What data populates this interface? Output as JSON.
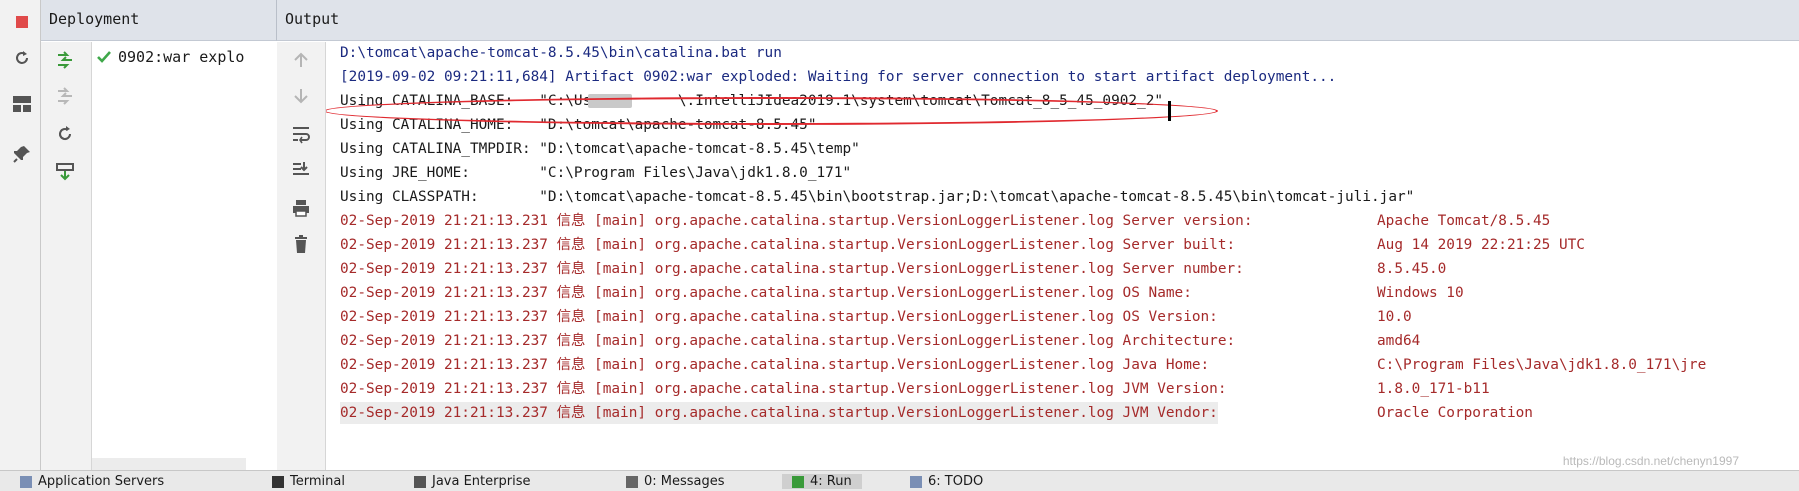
{
  "panels": {
    "deployment_title": "Deployment",
    "output_title": "Output"
  },
  "deployment": {
    "items": [
      {
        "label": "0902:war explo",
        "status": "deployed"
      }
    ]
  },
  "console": {
    "lines": [
      {
        "kind": "cmd",
        "text": "D:\\tomcat\\apache-tomcat-8.5.45\\bin\\catalina.bat run"
      },
      {
        "kind": "info",
        "text": "[2019-09-02 09:21:11,684] Artifact 0902:war exploded: Waiting for server connection to start artifact deployment..."
      },
      {
        "kind": "out",
        "text": "Using CATALINA_BASE:   \"C:\\Users\\      \\.IntelliJIdea2019.1\\system\\tomcat\\Tomcat_8_5_45_0902_2\""
      },
      {
        "kind": "out",
        "text": "Using CATALINA_HOME:   \"D:\\tomcat\\apache-tomcat-8.5.45\""
      },
      {
        "kind": "out",
        "text": "Using CATALINA_TMPDIR: \"D:\\tomcat\\apache-tomcat-8.5.45\\temp\""
      },
      {
        "kind": "out",
        "text": "Using JRE_HOME:        \"C:\\Program Files\\Java\\jdk1.8.0_171\""
      },
      {
        "kind": "out",
        "text": "Using CLASSPATH:       \"D:\\tomcat\\apache-tomcat-8.5.45\\bin\\bootstrap.jar;D:\\tomcat\\apache-tomcat-8.5.45\\bin\\tomcat-juli.jar\""
      },
      {
        "kind": "err",
        "text": "02-Sep-2019 21:21:13.231 信息 [main] org.apache.catalina.startup.VersionLoggerListener.log Server version:",
        "value": "Apache Tomcat/8.5.45"
      },
      {
        "kind": "err",
        "text": "02-Sep-2019 21:21:13.237 信息 [main] org.apache.catalina.startup.VersionLoggerListener.log Server built:",
        "value": "Aug 14 2019 22:21:25 UTC"
      },
      {
        "kind": "err",
        "text": "02-Sep-2019 21:21:13.237 信息 [main] org.apache.catalina.startup.VersionLoggerListener.log Server number:",
        "value": "8.5.45.0"
      },
      {
        "kind": "err",
        "text": "02-Sep-2019 21:21:13.237 信息 [main] org.apache.catalina.startup.VersionLoggerListener.log OS Name:",
        "value": "Windows 10"
      },
      {
        "kind": "err",
        "text": "02-Sep-2019 21:21:13.237 信息 [main] org.apache.catalina.startup.VersionLoggerListener.log OS Version:",
        "value": "10.0"
      },
      {
        "kind": "err",
        "text": "02-Sep-2019 21:21:13.237 信息 [main] org.apache.catalina.startup.VersionLoggerListener.log Architecture:",
        "value": "amd64"
      },
      {
        "kind": "err",
        "text": "02-Sep-2019 21:21:13.237 信息 [main] org.apache.catalina.startup.VersionLoggerListener.log Java Home:",
        "value": "C:\\Program Files\\Java\\jdk1.8.0_171\\jre"
      },
      {
        "kind": "err",
        "text": "02-Sep-2019 21:21:13.237 信息 [main] org.apache.catalina.startup.VersionLoggerListener.log JVM Version:",
        "value": "1.8.0_171-b11"
      },
      {
        "kind": "err",
        "text": "02-Sep-2019 21:21:13.237 信息 [main] org.apache.catalina.startup.VersionLoggerListener.log JVM Vendor:",
        "value": "Oracle Corporation"
      }
    ]
  },
  "statusbar": {
    "tabs": [
      "Application Servers",
      "Terminal",
      "Java Enterprise",
      "0: Messages",
      "4: Run",
      "6: TODO"
    ]
  },
  "watermark": "https://blog.csdn.net/chenyn1997",
  "colors": {
    "cmd": "#1b2a80",
    "stderr": "#a52a2a",
    "header_bg": "#dfe3ea",
    "highlight": "#e0292f"
  }
}
